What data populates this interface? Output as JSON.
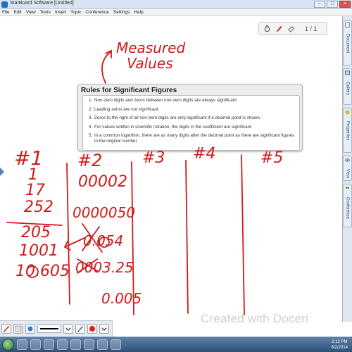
{
  "window": {
    "title": "StarBoard Software [Untitled]"
  },
  "menu": [
    "File",
    "Edit",
    "View",
    "Tools",
    "Insert",
    "Topic",
    "Conference",
    "Settings",
    "Help"
  ],
  "mini_toolbar": {
    "page_count": "1 / 1"
  },
  "sidebar": {
    "tabs": [
      "Document",
      "Gallery",
      "Properties",
      "View",
      "Conference"
    ]
  },
  "rules": {
    "title": "Rules for Significant Figures",
    "items": [
      {
        "num": "1.",
        "text": "Non-zero digits and zeros between non-zero digits are always significant."
      },
      {
        "num": "2.",
        "text": "Leading zeros are not significant."
      },
      {
        "num": "3.",
        "text": "Zeros to the right of all non-zero digits are only significant if a decimal point is shown."
      },
      {
        "num": "4.",
        "text": "For values written in scientific notation, the digits in the coefficient are significant."
      },
      {
        "num": "5.",
        "text": "In a common logarithm, there are as many digits after the decimal point as there are significant figures in the original number."
      }
    ]
  },
  "handwriting": {
    "measured_line1": "Measured",
    "measured_line2": "Values",
    "col1_header": "#1",
    "col2_header": "#2",
    "col3_header": "#3",
    "col4_header": "#4",
    "col5_header": "#5",
    "col1_values": [
      "1",
      "17",
      "252",
      "205",
      "1001",
      "10.605"
    ],
    "col2_values": [
      "00002",
      "0000050",
      "0.054",
      "0003.25",
      "0.005"
    ]
  },
  "watermark": "Created with Doceri",
  "taskbar": {
    "time": "2:12 PM",
    "date": "6/2/2014"
  },
  "colors": {
    "ink": "#d11a1a",
    "accent": "#1f6fbf"
  }
}
